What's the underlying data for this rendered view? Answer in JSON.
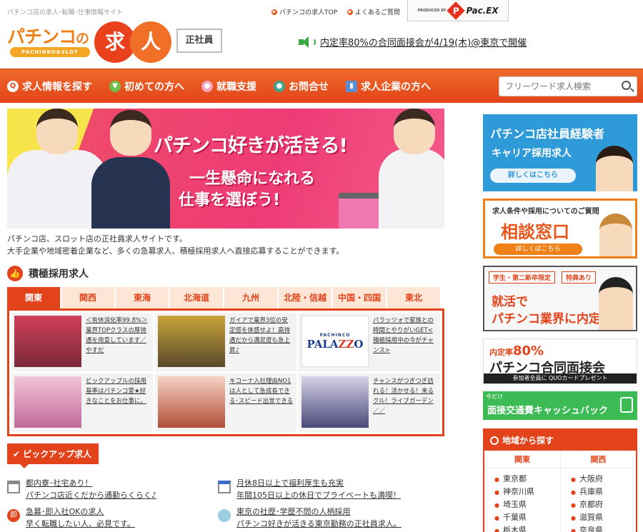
{
  "header": {
    "tagline": "パチンコ店の求人･転職･仕事情報サイト",
    "links": [
      "パチンコの求人TOP",
      "よくあるご質問"
    ],
    "partner_small": "PRODUCED BY",
    "partner_name": "Pac.EX",
    "logo_main": "パチンコ",
    "logo_no": "の",
    "logo_sub": "PACHINKO&SLOT",
    "logo_kanji1": "求",
    "logo_kanji2": "人",
    "badge": "正社員",
    "announce": "内定率80%の合同面接会が4/19(木)@東京で開催"
  },
  "nav": {
    "items": [
      "求人情報を探す",
      "初めての方へ",
      "就職支援",
      "お問合せ",
      "求人企業の方へ"
    ],
    "search_placeholder": "フリーワード求人検索"
  },
  "hero": {
    "headline": "パチンコ好きが活きる!",
    "line1": "一生懸命になれる",
    "line2": "仕事を選ぼう!"
  },
  "intro": {
    "line1": "パチンコ店、スロット店の正社員求人サイトです。",
    "line2": "大手企業や地域密着企業など、多くの急募求人、積極採用求人へ直接応募することができます。"
  },
  "active_jobs": {
    "title": "積極採用求人",
    "tabs": [
      "関東",
      "関西",
      "東海",
      "北海道",
      "九州",
      "北陸・信越",
      "中国・四国",
      "東北"
    ],
    "jobs": [
      {
        "text": "＜有休消化率99.8%＞業界TOPクラスの厚待遇を用意しています／やすだ"
      },
      {
        "text": "ガイアで業界3位の安定感を体感せよ！高待遇だから満足度も急上昇♪"
      },
      {
        "logo_small": "PACHINCO",
        "logo_big": "PALA",
        "logo_zz": "ZZ",
        "logo_end": "O",
        "text": "パラッツォで家族との時間とやりがいGET<積極採用中の今がチャンス>"
      },
      {
        "text": "ビックアップルの採用基準はパチンコ愛★好きなことをお仕事に。"
      },
      {
        "text": "キコーナ入社理由NO1は人として急成長できる･スピード出世できる"
      },
      {
        "text": "チャンスがつぎつぎ訪れる！活かせる！来るクル！ライブガーデン／／"
      }
    ]
  },
  "pickup": {
    "title": "ピックアップ求人",
    "items": [
      {
        "line1": "都内寮･社宅あり！",
        "line2": "パチンコ店近くだから通勤らくらく♪"
      },
      {
        "line1": "月休8日以上で福利厚生も充実",
        "line2": "年間105日以上の休日でプライベートも満喫！"
      },
      {
        "icon_text": "即",
        "line1": "急募･即入社OKの求人",
        "line2": "早く転職したい人、必見です。"
      },
      {
        "line1": "東京の社歴･学歴不問の人柄採用",
        "line2": "パチンコ好きが活きる東京勤務の正社員求人。"
      }
    ]
  },
  "sidebar": {
    "banner1": {
      "line1": "パチンコ店社員経験者",
      "line2": "キャリア採用求人",
      "button": "詳しくはこちら"
    },
    "banner2": {
      "line1": "求人条件や採用についてのご質問",
      "line2": "相談窓口",
      "button": "詳しくはこちら"
    },
    "banner3": {
      "chip1": "学生・第二新卒限定",
      "chip2": "特典あり",
      "line1": "就活で",
      "line2": "パチンコ業界に内定。"
    },
    "banner4": {
      "prefix": "内定率",
      "rate": "80%",
      "line1": "パチンコ合同面接会",
      "line2": "参加者全員に QUOカードプレゼント"
    },
    "banner5": {
      "line1": "今だけ",
      "line2": "面接交通費キャッシュバック"
    },
    "region": {
      "title": "地域から探す",
      "kanto": {
        "name": "関東",
        "prefs": [
          "東京都",
          "神奈川県",
          "埼玉県",
          "千葉県",
          "栃木県"
        ]
      },
      "kansai": {
        "name": "関西",
        "prefs": [
          "大阪府",
          "兵庫県",
          "京都府",
          "滋賀県",
          "奈良県"
        ]
      }
    }
  }
}
